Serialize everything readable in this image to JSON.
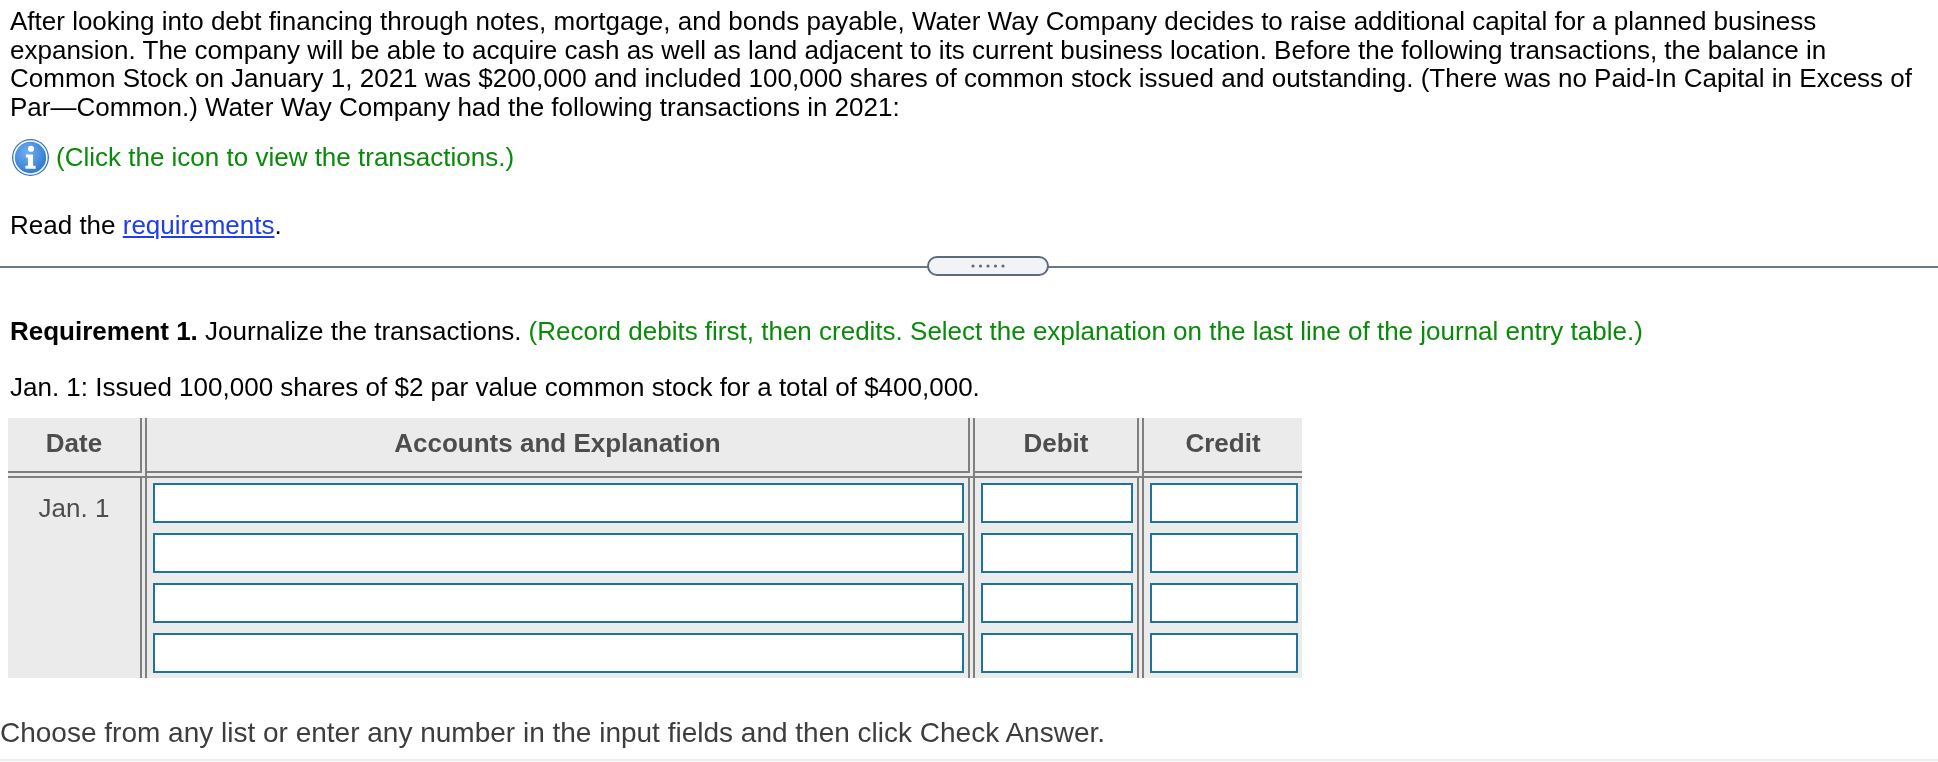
{
  "problem": {
    "paragraph": "After looking into debt financing through notes, mortgage, and bonds payable, Water Way Company decides to raise additional capital for a planned business expansion. The company will be able to acquire cash as well as land adjacent to its current business location. Before the following transactions, the balance in Common Stock on January 1, 2021 was $200,000 and included 100,000 shares of common stock issued and outstanding. (There was no Paid-In Capital in Excess of Par—Common.) Water Way Company had the following transactions in 2021:",
    "info_hint": "(Click the icon to view the transactions.)",
    "read_prompt": {
      "text": "Read the",
      "link": "requirements",
      "end": "."
    }
  },
  "requirement": {
    "text": "**Requirement 1.** Journalize the transactions.",
    "instruction": "(Record debits first, then credits. Select the explanation on the last line of the journal entry table.)"
  },
  "transaction": "Jan. 1: Issued 100,000 shares of $2 par value common stock for a total of $400,000.",
  "journal": {
    "columns": [
      "Date",
      "Accounts and Explanation",
      "Debit",
      "Credit"
    ],
    "date": "Jan. 1",
    "rows": [
      {
        "kind": "entry"
      },
      {
        "kind": "entry"
      },
      {
        "kind": "entry"
      },
      {
        "kind": "entry"
      }
    ]
  },
  "footer": "Choose from any list or enter any number in the input fields and then click Check Answer."
}
